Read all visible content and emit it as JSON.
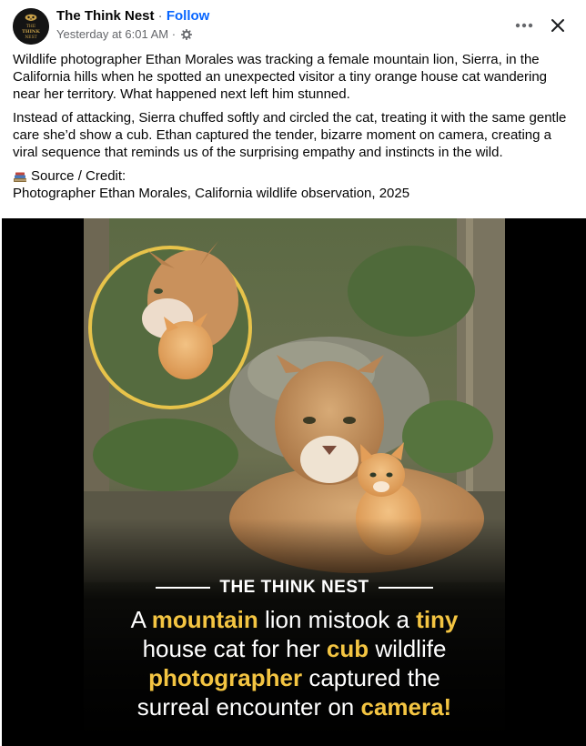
{
  "header": {
    "page_name": "The Think Nest",
    "separator": " · ",
    "follow_label": "Follow",
    "timestamp": "Yesterday at 6:01 AM",
    "meta_separator": " · ",
    "audience_icon": "gear-icon",
    "avatar_text_top": "THE",
    "avatar_text_mid": "THINK",
    "avatar_text_bot": "NEST"
  },
  "post": {
    "paragraph_1": "Wildlife photographer Ethan Morales was tracking a female mountain lion, Sierra, in the California hills when he spotted an unexpected visitor a tiny orange house cat wandering near her territory. What happened next left him stunned.",
    "paragraph_2": "Instead of attacking, Sierra chuffed softly and circled the cat, treating it with the same gentle care she’d show a cub. Ethan captured the tender, bizarre moment on camera, creating a viral sequence that reminds us of the surprising empathy and instincts in the wild.",
    "source_label": "Source / Credit:",
    "source_text": "Photographer Ethan Morales, California wildlife observation, 2025",
    "source_icon": "books-icon"
  },
  "media": {
    "brand": "THE THINK NEST",
    "line1": [
      {
        "t": "A ",
        "h": false
      },
      {
        "t": "mountain",
        "h": true
      },
      {
        "t": " lion mistook a ",
        "h": false
      },
      {
        "t": "tiny",
        "h": true
      }
    ],
    "line2": [
      {
        "t": "house cat for her ",
        "h": false
      },
      {
        "t": "cub",
        "h": true
      },
      {
        "t": " wildlife",
        "h": false
      }
    ],
    "line3": [
      {
        "t": "photographer",
        "h": true
      },
      {
        "t": " captured the",
        "h": false
      }
    ],
    "line4": [
      {
        "t": "surreal encounter on ",
        "h": false
      },
      {
        "t": "camera!",
        "h": true
      }
    ],
    "accent_color": "#f4c542"
  },
  "colors": {
    "link_blue": "#0866ff",
    "meta_gray": "#65676b"
  }
}
